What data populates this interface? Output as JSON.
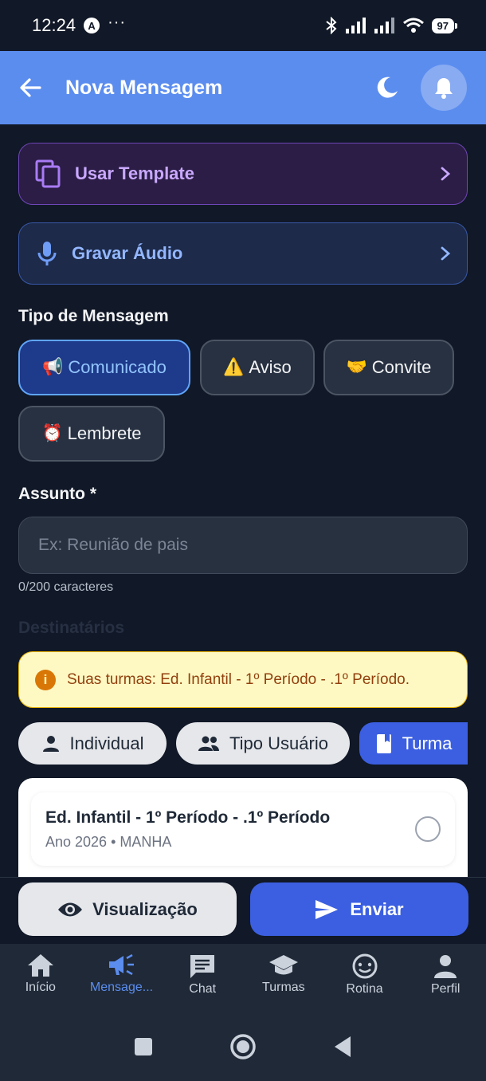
{
  "status_bar": {
    "time": "12:24",
    "battery": "97"
  },
  "app_bar": {
    "title": "Nova Mensagem"
  },
  "actions": {
    "template_label": "Usar Template",
    "audio_label": "Gravar Áudio"
  },
  "message_type": {
    "label": "Tipo de Mensagem",
    "selected": "Comunicado",
    "options": [
      {
        "emoji": "📢",
        "label": "Comunicado"
      },
      {
        "emoji": "⚠️",
        "label": "Aviso"
      },
      {
        "emoji": "🤝",
        "label": "Convite"
      },
      {
        "emoji": "⏰",
        "label": "Lembrete"
      }
    ]
  },
  "subject": {
    "label": "Assunto *",
    "placeholder": "Ex: Reunião de pais",
    "value": "",
    "counter": "0/200 caracteres"
  },
  "recipients": {
    "label": "Destinatários",
    "info": "Suas turmas: Ed. Infantil - 1º Período - .1º Período.",
    "tabs": [
      {
        "label": "Individual"
      },
      {
        "label": "Tipo Usuário"
      },
      {
        "label": "Turma"
      }
    ],
    "selected_tab": "Turma",
    "classes": [
      {
        "title": "Ed. Infantil - 1º Período - .1º Período",
        "subtitle": "Ano 2026 • MANHA",
        "selected": false
      }
    ]
  },
  "footer": {
    "preview_label": "Visualização",
    "send_label": "Enviar"
  },
  "nav": {
    "active": "Mensagens",
    "items": [
      {
        "label": "Início",
        "icon": "home-icon"
      },
      {
        "label": "Mensage...",
        "icon": "megaphone-icon"
      },
      {
        "label": "Chat",
        "icon": "chat-icon"
      },
      {
        "label": "Turmas",
        "icon": "school-icon"
      },
      {
        "label": "Rotina",
        "icon": "baby-face-icon"
      },
      {
        "label": "Perfil",
        "icon": "person-icon"
      }
    ]
  },
  "colors": {
    "app_bar": "#5b8def",
    "primary": "#3b5fe0",
    "background": "#111827"
  }
}
